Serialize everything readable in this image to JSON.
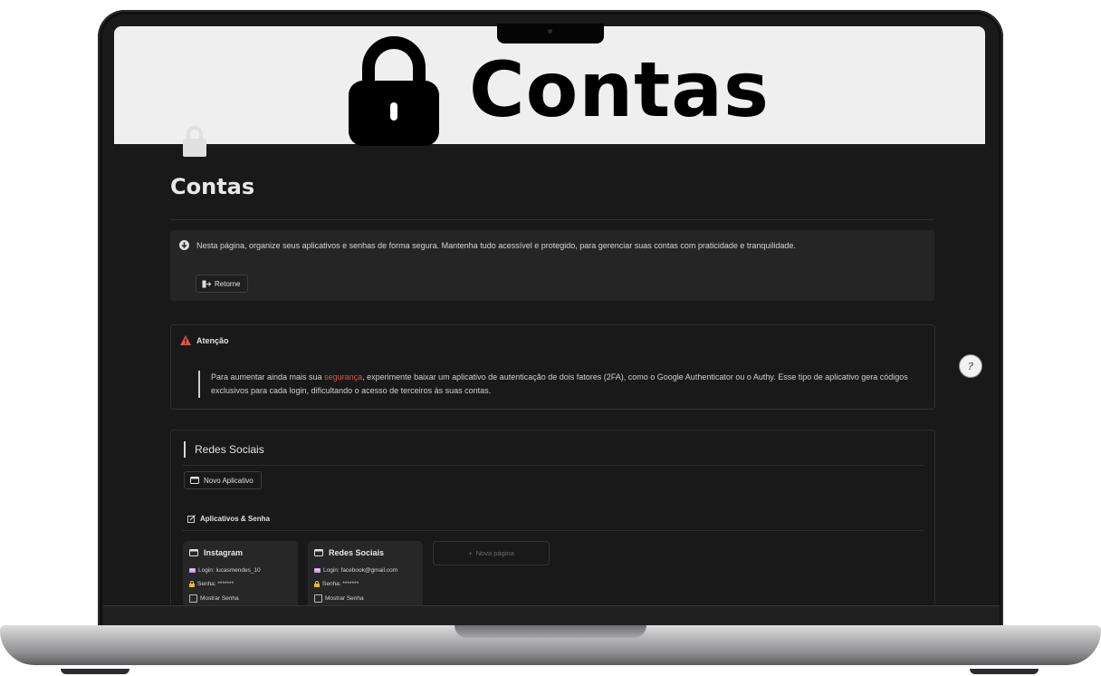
{
  "cover": {
    "title": "Contas"
  },
  "page": {
    "title": "Contas"
  },
  "intro_callout": {
    "text": "Nesta página, organize seus aplicativos e senhas de forma segura. Mantenha tudo acessível e protegido, para gerenciar suas contas com praticidade e tranquilidade.",
    "button_label": "Retorne"
  },
  "warning_callout": {
    "heading": "Atenção",
    "text_before": "Para aumentar ainda mais sua ",
    "highlight": "segurança",
    "text_after": ", experimente baixar um aplicativo de autenticação de dois fatores (2FA), como o Google Authenticator ou o Authy. Esse tipo de aplicativo gera códigos exclusivos para cada login, dificultando o acesso de terceiros às suas contas."
  },
  "section": {
    "title": "Redes Sociais",
    "new_button_label": "Novo Aplicativo",
    "view_label": "Aplicativos & Senha",
    "cards": [
      {
        "title": "Instagram",
        "login": "Login: lucasmendes_10",
        "password": "Senha: *******",
        "toggle": "Mostrar Senha"
      },
      {
        "title": "Redes Sociais",
        "login": "Login: facebook@gmail.com",
        "password": "Senha: *******",
        "toggle": "Mostrar Senha"
      }
    ],
    "new_page_label": "Nova página"
  },
  "help": {
    "glyph": "?"
  },
  "colors": {
    "screen_bg": "#191919",
    "cover_bg": "#efefef",
    "highlight": "#e0564a",
    "warning": "#e0564a"
  }
}
